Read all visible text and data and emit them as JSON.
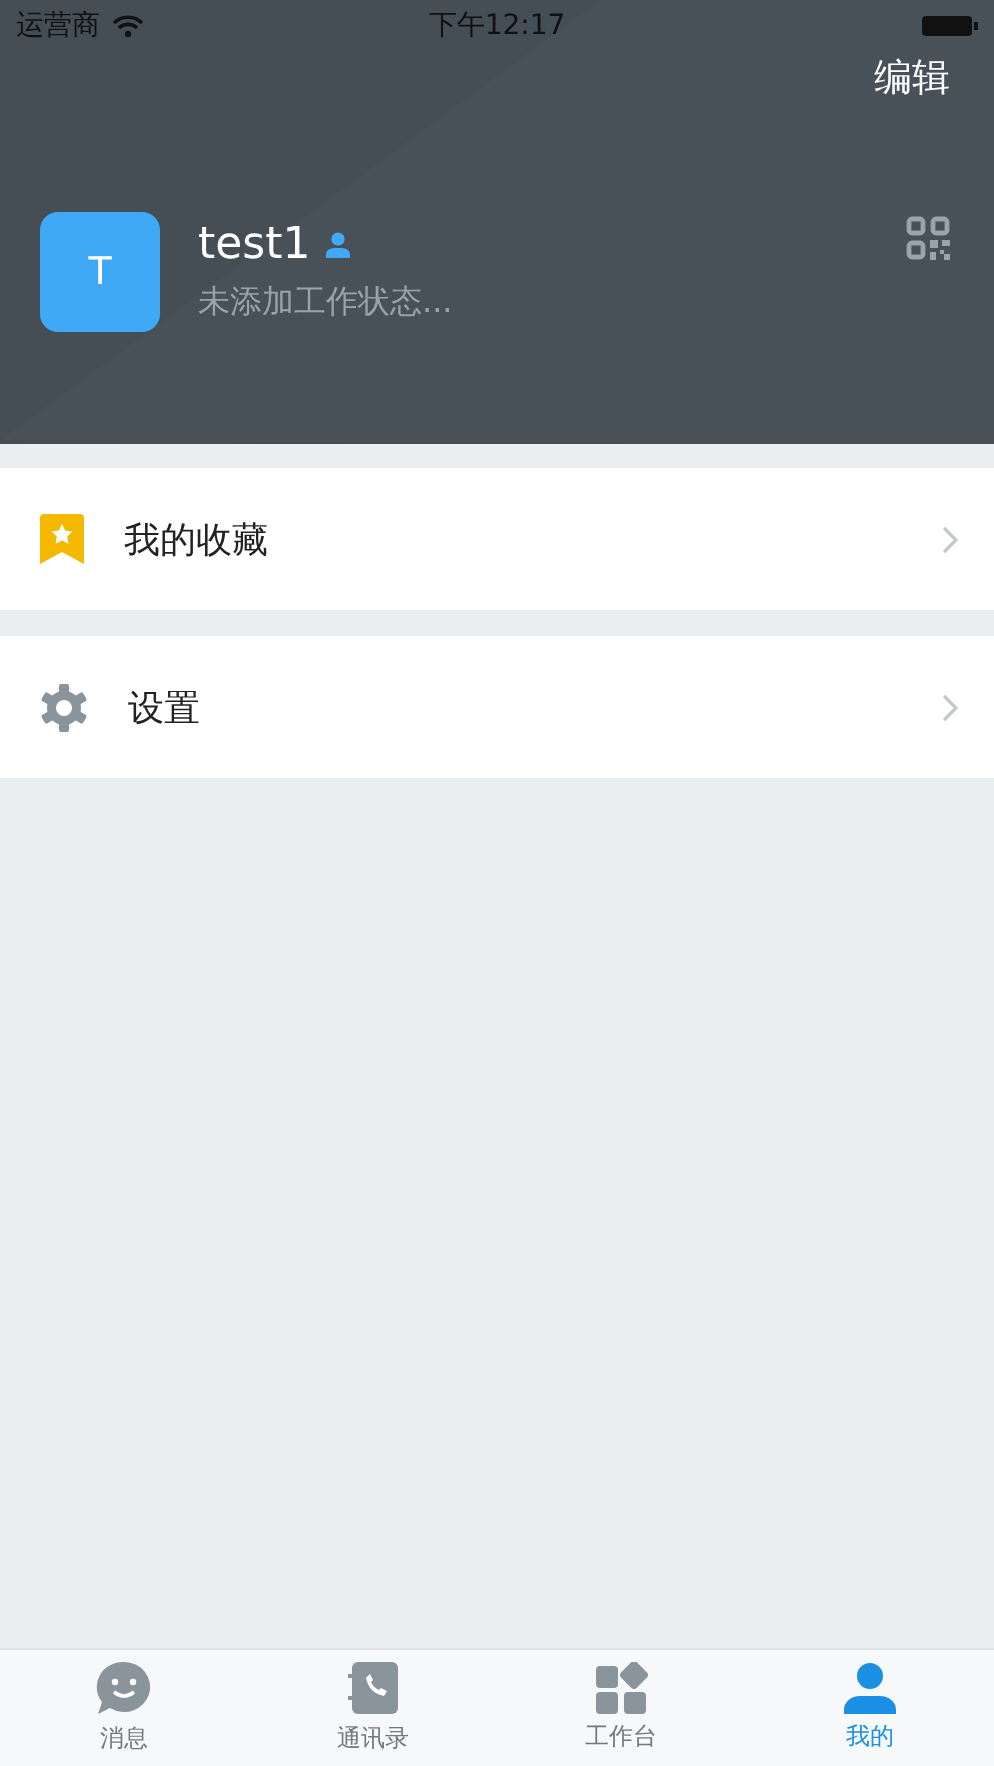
{
  "status_bar": {
    "carrier": "运营商",
    "time": "下午12:17"
  },
  "header": {
    "action": "编辑",
    "avatar_letter": "T",
    "name": "test1",
    "status": "未添加工作状态..."
  },
  "menu": [
    {
      "kind": "favorites",
      "label": "我的收藏"
    },
    {
      "kind": "settings",
      "label": "设置"
    }
  ],
  "tabs": [
    {
      "kind": "messages",
      "label": "消息",
      "selected": false
    },
    {
      "kind": "contacts",
      "label": "通讯录",
      "selected": false
    },
    {
      "kind": "workbench",
      "label": "工作台",
      "selected": false
    },
    {
      "kind": "me",
      "label": "我的",
      "selected": true
    }
  ]
}
